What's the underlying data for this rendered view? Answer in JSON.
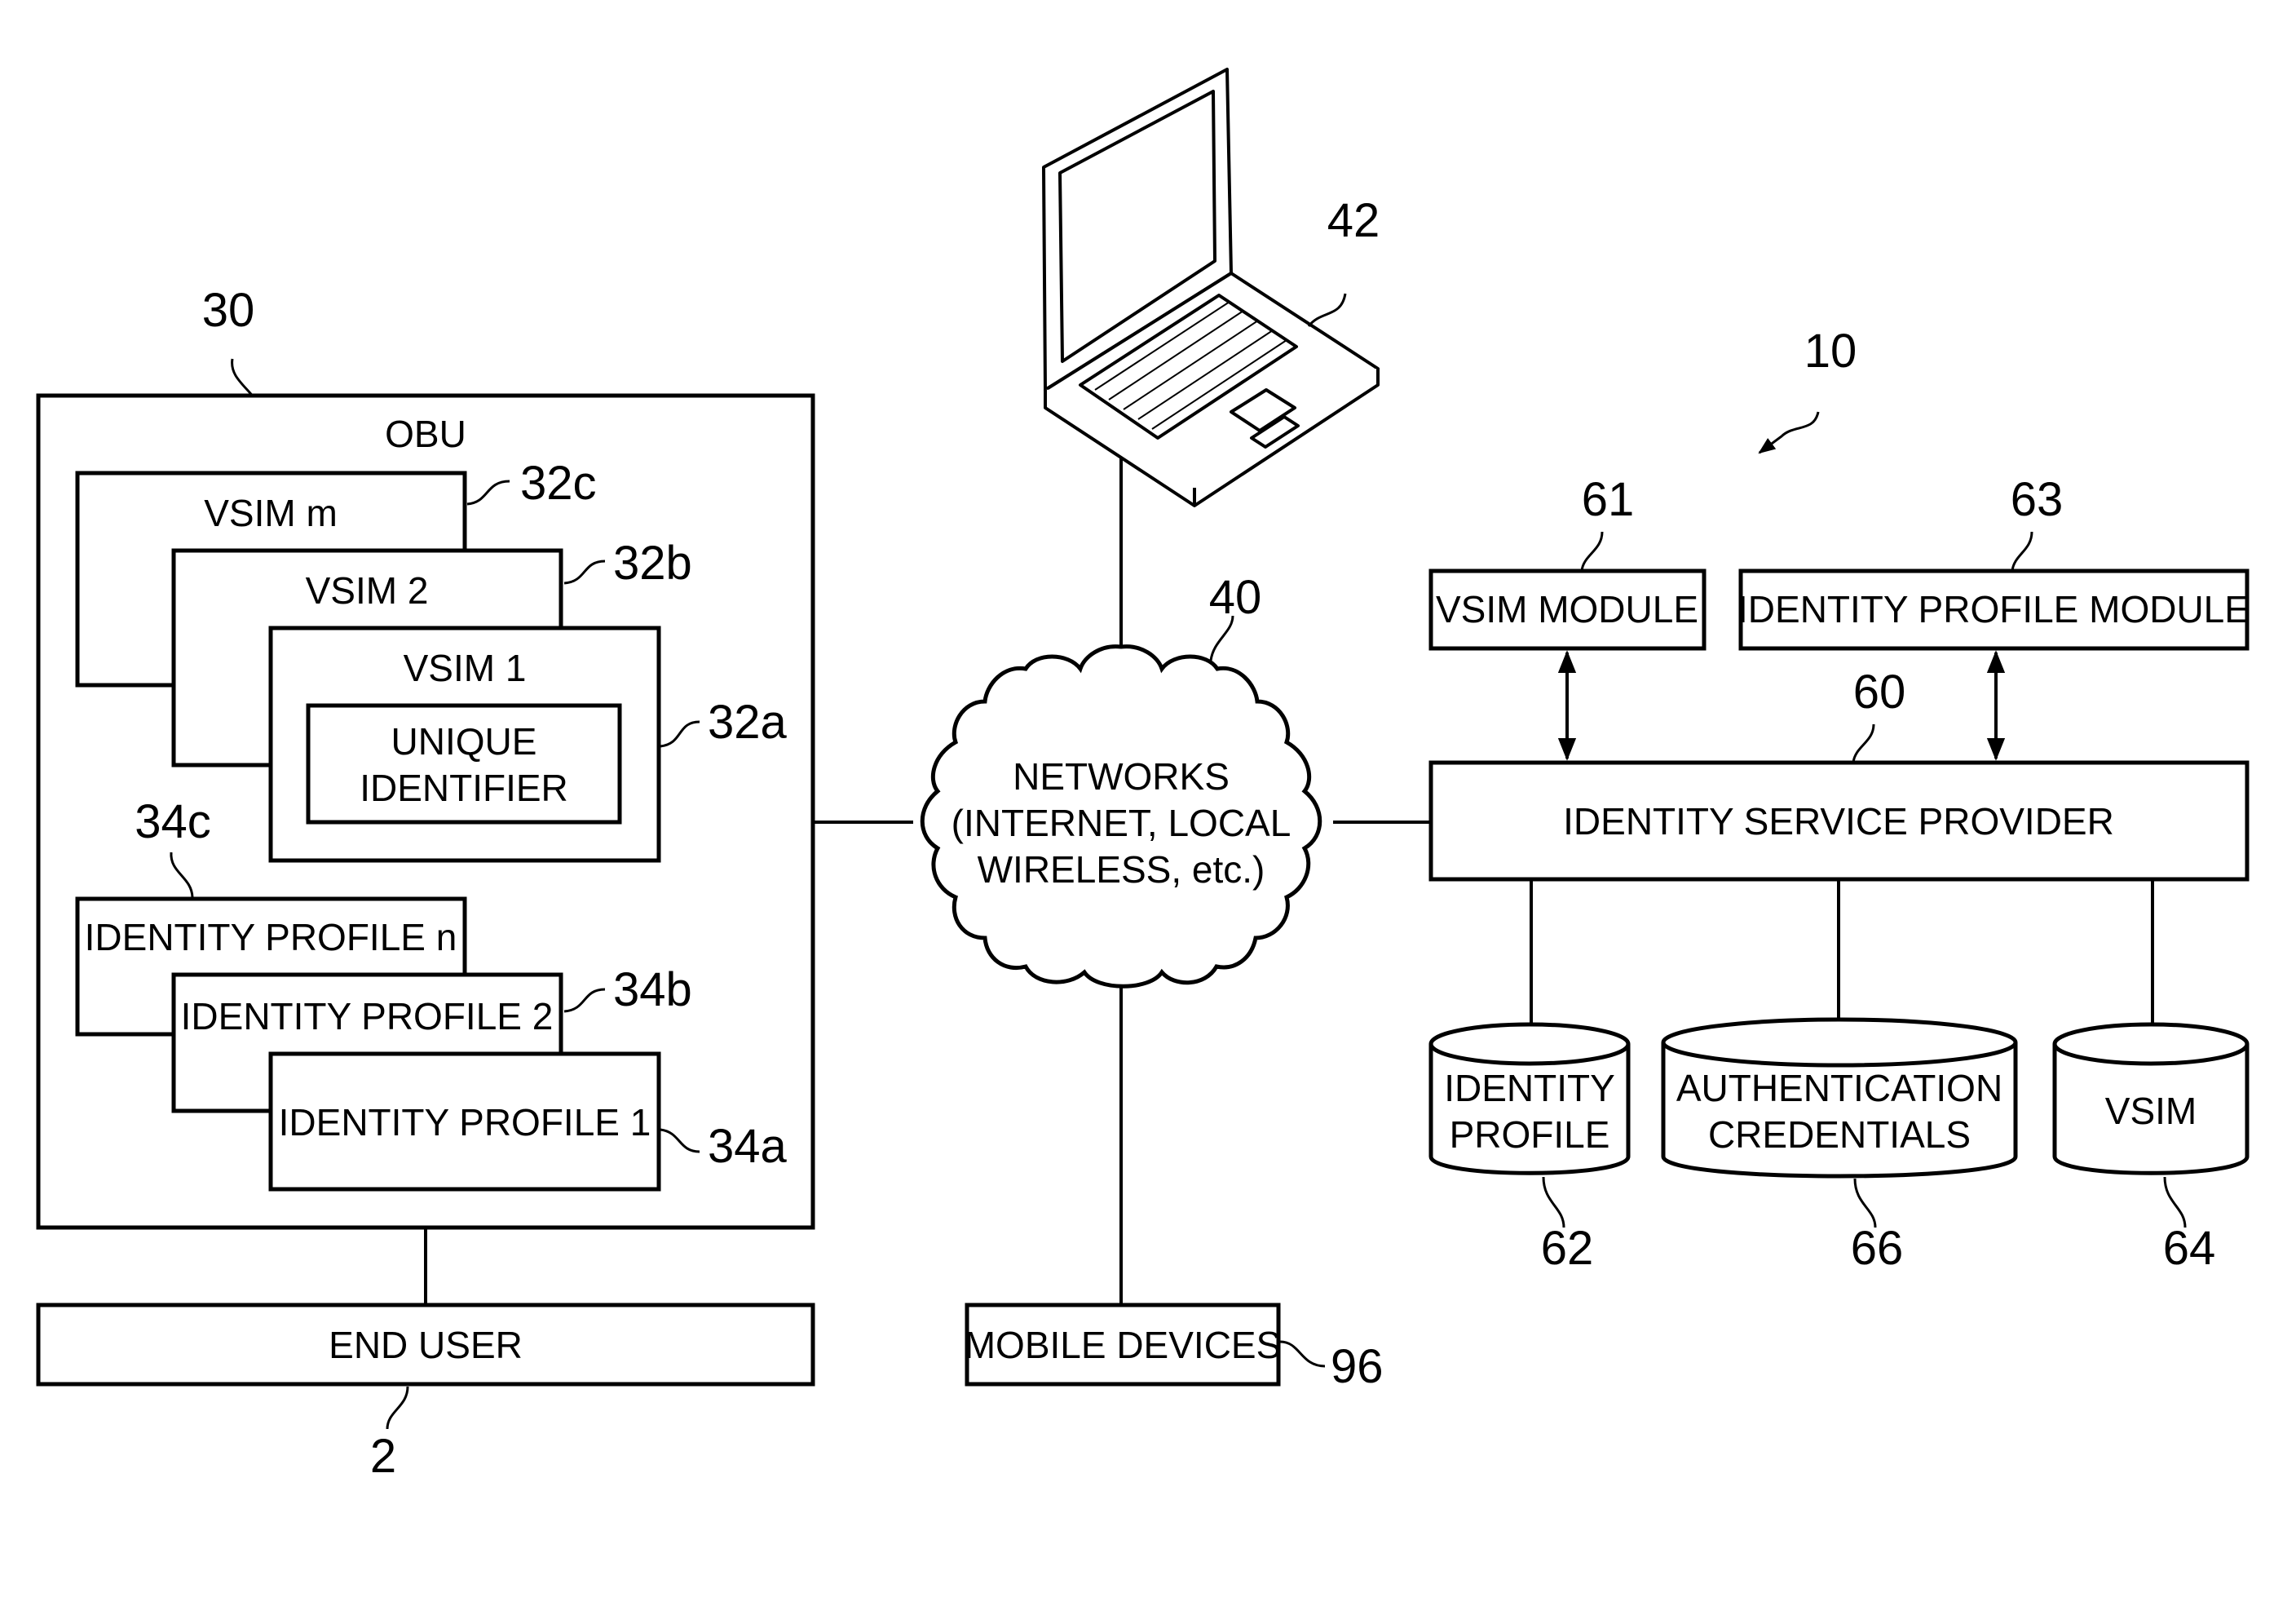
{
  "figure": {
    "system_ref": "10",
    "obu": {
      "ref": "30",
      "title": "OBU",
      "vsims": [
        {
          "label": "VSIM m",
          "ref": "32c"
        },
        {
          "label": "VSIM 2",
          "ref": "32b"
        },
        {
          "label": "VSIM 1",
          "ref": "32a",
          "inner_label_line1": "UNIQUE",
          "inner_label_line2": "IDENTIFIER"
        }
      ],
      "identity_profiles": [
        {
          "label": "IDENTITY PROFILE n",
          "ref": "34c"
        },
        {
          "label": "IDENTITY PROFILE 2",
          "ref": "34b"
        },
        {
          "label": "IDENTITY PROFILE 1",
          "ref": "34a"
        }
      ]
    },
    "end_user": {
      "label": "END USER",
      "ref": "2"
    },
    "laptop": {
      "ref": "42",
      "icon": "laptop-icon"
    },
    "network": {
      "ref": "40",
      "line1": "NETWORKS",
      "line2": "(INTERNET, LOCAL",
      "line3": "WIRELESS, etc.)"
    },
    "mobile_devices": {
      "label": "MOBILE DEVICES",
      "ref": "96"
    },
    "identity_service_provider": {
      "label": "IDENTITY SERVICE PROVIDER",
      "ref": "60"
    },
    "vsim_module": {
      "label": "VSIM MODULE",
      "ref": "61"
    },
    "identity_profile_module": {
      "label": "IDENTITY PROFILE MODULE",
      "ref": "63"
    },
    "databases": [
      {
        "line1": "IDENTITY",
        "line2": "PROFILE",
        "ref": "62"
      },
      {
        "line1": "AUTHENTICATION",
        "line2": "CREDENTIALS",
        "ref": "66"
      },
      {
        "line1": "VSIM",
        "line2": "",
        "ref": "64"
      }
    ]
  }
}
